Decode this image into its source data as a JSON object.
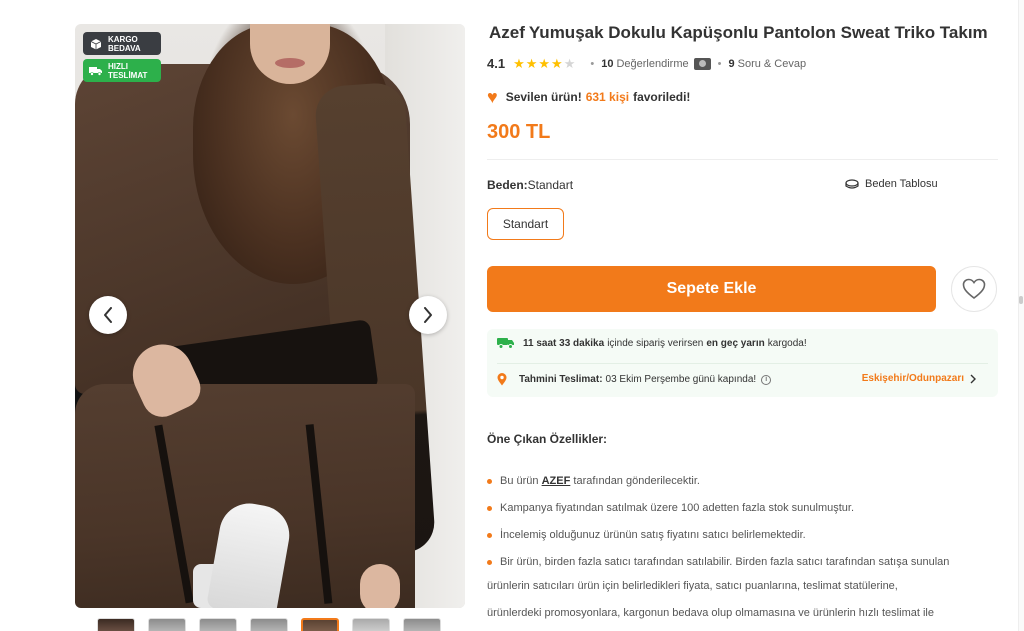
{
  "gallery": {
    "badges": [
      {
        "line1": "KARGO",
        "line2": "BEDAVA",
        "icon": "box-icon"
      },
      {
        "line1": "HIZLI",
        "line2": "TESLİMAT",
        "icon": "truck-icon"
      }
    ],
    "thumbnail_count": 7,
    "active_thumbnail": 5
  },
  "product": {
    "brand": "Azef",
    "name": "Yumuşak Dokulu Kapüşonlu Pantolon Sweat Triko Takım",
    "rating": "4.1",
    "stars_filled": 4,
    "stars_total": 5,
    "reviews_count": "10",
    "reviews_label": "Değerlendirme",
    "qa_count": "9",
    "qa_label": "Soru & Cevap",
    "favorite_prefix": "Sevilen ürün!",
    "favorite_count": "631 kişi",
    "favorite_suffix": "favoriledi!",
    "price": "300 TL"
  },
  "size": {
    "label": "Beden:",
    "value": "Standart",
    "table_link": "Beden Tablosu",
    "option": "Standart"
  },
  "actions": {
    "add_to_cart": "Sepete Ekle"
  },
  "delivery": {
    "time_strong": "11 saat 33 dakika",
    "time_middle": "içinde sipariş verirsen",
    "time_strong2": "en geç yarın",
    "time_suffix": "kargoda!",
    "estimate_label": "Tahmini Teslimat:",
    "estimate_value": "03 Ekim Perşembe günü kapında!",
    "location": "Eskişehir/Odunpazarı"
  },
  "features": {
    "title": "Öne Çıkan Özellikler:",
    "item1_prefix": "Bu ürün",
    "item1_seller": "AZEF",
    "item1_suffix": "tarafından gönderilecektir.",
    "item2": "Kampanya fiyatından satılmak üzere 100 adetten fazla stok sunulmuştur.",
    "item3": "İncelemiş olduğunuz ürünün satış fiyatını satıcı belirlemektedir.",
    "item4_line1": "Bir ürün, birden fazla satıcı tarafından satılabilir. Birden fazla satıcı tarafından satışa sunulan",
    "item4_line2": "ürünlerin satıcıları ürün için belirledikleri fiyata, satıcı puanlarına, teslimat statülerine,",
    "item4_line3": "ürünlerdeki promosyonlara, kargonun bedava olup olmamasına ve ürünlerin hızlı teslimat ile"
  },
  "colors": {
    "accent": "#f27a1a",
    "star": "#ffc000",
    "fast_badge": "#2db04b",
    "cargo_badge": "#3a3d42",
    "delivery_bg": "#f5fbf6"
  }
}
